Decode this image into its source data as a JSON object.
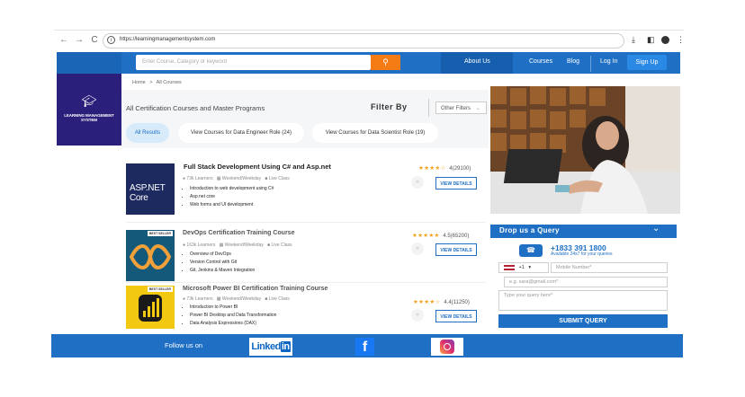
{
  "browser": {
    "url": "https://learningmanagementsystem.com"
  },
  "header": {
    "search_placeholder": "Enter Course, Category or keyword",
    "search_icon": "search-icon",
    "nav": {
      "about": "About Us",
      "courses": "Courses",
      "blog": "Blog",
      "login": "Log In",
      "signup": "Sign Up"
    },
    "brand_color": "#1f6fc4",
    "accent_color": "#f57c14"
  },
  "logo": {
    "text": "LEARNING MANAGEMENT SYSTEM",
    "icon": "graduation-cap-icon"
  },
  "breadcrumb": {
    "home": "Home",
    "separator": ">",
    "current": "All Courses"
  },
  "filters": {
    "title": "All Certification Courses and Master Programs",
    "filter_by": "Filter By",
    "other_filters": "Other Filters",
    "chips": [
      "All Results",
      "View Courses for Data Engineer Role (24)",
      "View Courses for Data Scientist Role (19)"
    ]
  },
  "courses": [
    {
      "title": "Full Stack Development Using C# and Asp.net",
      "learners": "73k Learners",
      "schedule": "Weekend/Weekday",
      "mode": "Live Class",
      "bullets": [
        "Introduction to web development using C#",
        "Asp.net core",
        "Web forms and UI development"
      ],
      "stars": "★★★★☆",
      "rating": "4",
      "reviews": "(29100)",
      "cta": "VIEW DETAILS",
      "thumb_text": "ASP.NET Core"
    },
    {
      "title": "DevOps Certification Training Course",
      "learners": "163k Learners",
      "schedule": "Weekend/Weekday",
      "mode": "Live Class",
      "bullets": [
        "Overview of DevOps",
        "Version Control with Git",
        "Git, Jenkins & Maven Integration"
      ],
      "stars": "★★★★★",
      "rating": "4.5",
      "reviews": "(65200)",
      "cta": "VIEW DETAILS",
      "badge": "BEST SELLER"
    },
    {
      "title": "Microsoft Power BI Certification Training Course",
      "learners": "73k Learners",
      "schedule": "Weekend/Weekday",
      "mode": "Live Class",
      "bullets": [
        "Introduction to Power BI",
        "Power BI Desktop and Data Transformation",
        "Data Analysis Expressions (DAX)"
      ],
      "stars": "★★★★☆",
      "rating": "4.4",
      "reviews": "(11250)",
      "cta": "VIEW DETAILS",
      "badge": "BEST SELLER"
    }
  ],
  "query": {
    "title": "Drop us a Query",
    "phone": "+1833 391 1800",
    "availability": "Available 24x7 for your queries",
    "country_code": "+1",
    "mobile_placeholder": "Mobile Number*",
    "email_placeholder": "e.g. sara@gmail.com*",
    "query_placeholder": "Type your query here*",
    "submit": "SUBMIT QUERY"
  },
  "footer": {
    "follow": "Follow us on",
    "social": [
      "linkedin-icon",
      "facebook-icon",
      "instagram-icon"
    ],
    "linkedin_text": "Linked"
  }
}
